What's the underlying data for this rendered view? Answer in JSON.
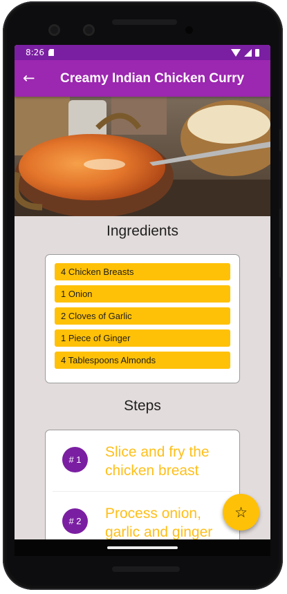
{
  "status_bar": {
    "time": "8:26"
  },
  "app_bar": {
    "title": "Creamy Indian Chicken Curry",
    "back_icon": "arrow-left-icon"
  },
  "hero": {
    "image": "chicken-curry-photo"
  },
  "ingredients": {
    "heading": "Ingredients",
    "items": [
      "4 Chicken Breasts",
      "1 Onion",
      "2 Cloves of Garlic",
      "1 Piece of Ginger",
      "4 Tablespoons Almonds"
    ]
  },
  "steps": {
    "heading": "Steps",
    "items": [
      {
        "number": "# 1",
        "text": "Slice and fry the chicken breast"
      },
      {
        "number": "# 2",
        "text": "Process onion, garlic and ginger"
      }
    ]
  },
  "fab": {
    "icon": "star-icon"
  },
  "colors": {
    "primary": "#9c27b0",
    "primary_dark": "#7b1fa2",
    "accent": "#ffc107",
    "background": "#e3dcdc"
  }
}
